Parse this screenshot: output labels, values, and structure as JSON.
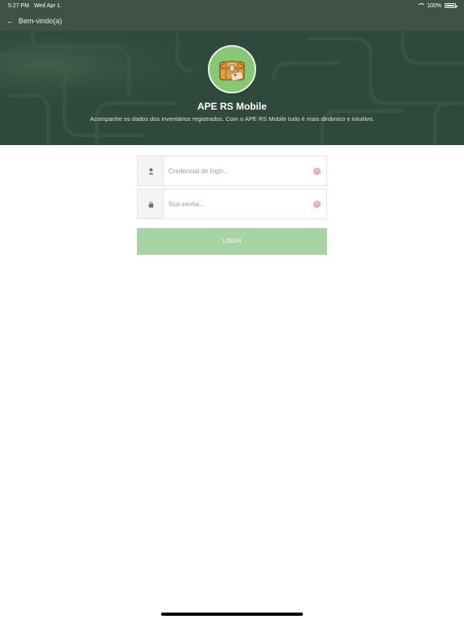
{
  "status": {
    "time": "5:27 PM",
    "date": "Wed Apr 1",
    "battery": "100%",
    "icons": [
      "wifi-icon",
      "battery-icon"
    ]
  },
  "nav": {
    "back_icon": "←",
    "title": "Bem-vindo(a)"
  },
  "header": {
    "app_name": "APE RS Mobile",
    "description": "Acompanhe os dados dos inventários registrados. Com o APE RS Mobile tudo é mais dinâmico e intuitivo."
  },
  "form": {
    "login": {
      "placeholder": "Credencial de login...",
      "value": ""
    },
    "password": {
      "placeholder": "Sua senha...",
      "value": ""
    },
    "clear_icon": "×",
    "submit_label": "LOGIN"
  },
  "colors": {
    "header_bg": "#2f4a3c",
    "bars_bg": "#3e5245",
    "button_bg": "#a8d3a3",
    "clear_icon": "#f5a9a9"
  }
}
